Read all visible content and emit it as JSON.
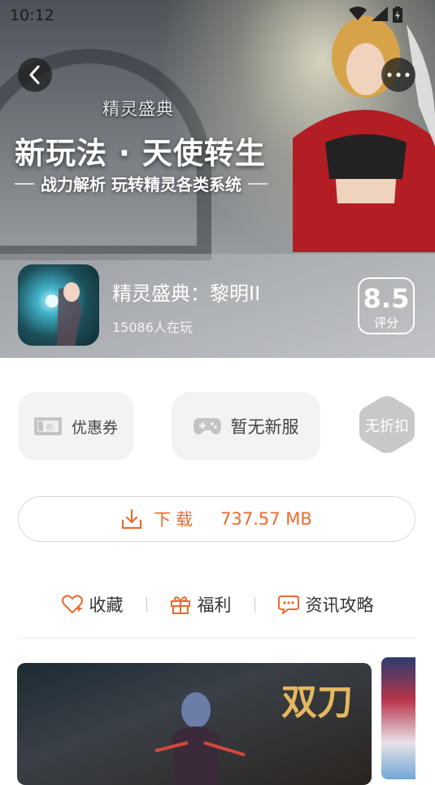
{
  "status": {
    "time": "10:12"
  },
  "hero": {
    "logo": "精灵盛典",
    "headline": "新玩法 · 天使转生",
    "subline": "战力解析  玩转精灵各类系统"
  },
  "app": {
    "name": "精灵盛典：黎明II",
    "players": "15086人在玩",
    "score": "8.5",
    "score_label": "评分"
  },
  "chips": {
    "coupon": "优惠券",
    "server": "暂无新服",
    "discount": "无折扣"
  },
  "download": {
    "label": "下载",
    "size": "737.57 MB"
  },
  "actions": {
    "favorite": "收藏",
    "welfare": "福利",
    "news": "资讯攻略"
  },
  "colors": {
    "accent": "#ee6a2c",
    "chip_bg": "#f3f3f3"
  }
}
